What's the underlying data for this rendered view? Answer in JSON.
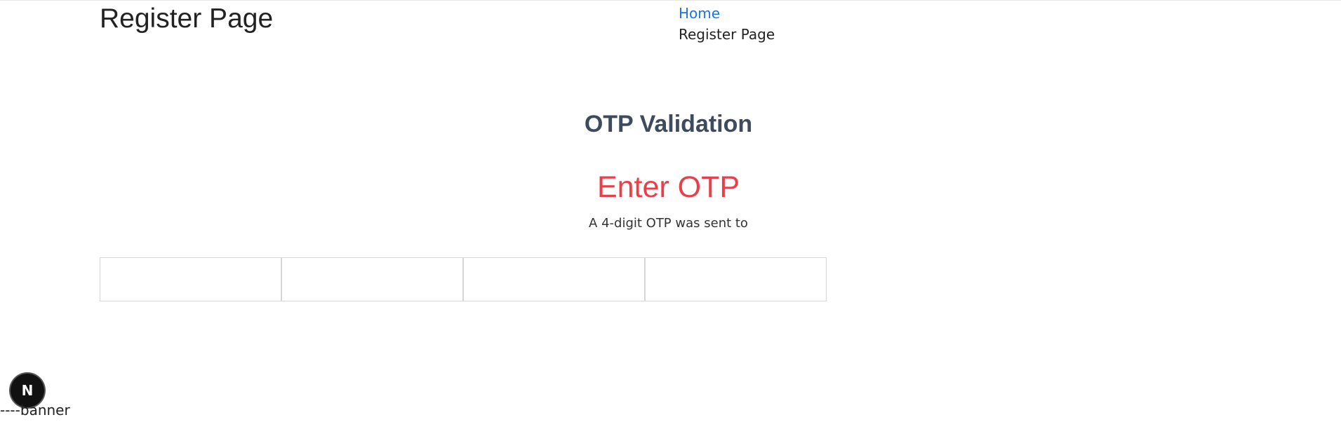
{
  "header": {
    "title": "Register Page",
    "breadcrumb": {
      "home_label": "Home",
      "current_label": "Register Page"
    }
  },
  "main": {
    "section_title": "OTP Validation",
    "otp_heading": "Enter OTP",
    "otp_subtext": "A 4-digit OTP was sent to",
    "otp_inputs": [
      {
        "value": ""
      },
      {
        "value": ""
      },
      {
        "value": ""
      },
      {
        "value": ""
      }
    ]
  },
  "footer": {
    "badge_letter": "N",
    "banner_text": "----banner"
  },
  "colors": {
    "link": "#1a73e8",
    "section_title": "#3d4b5c",
    "otp_heading": "#e8404a",
    "badge_bg": "#111111"
  }
}
